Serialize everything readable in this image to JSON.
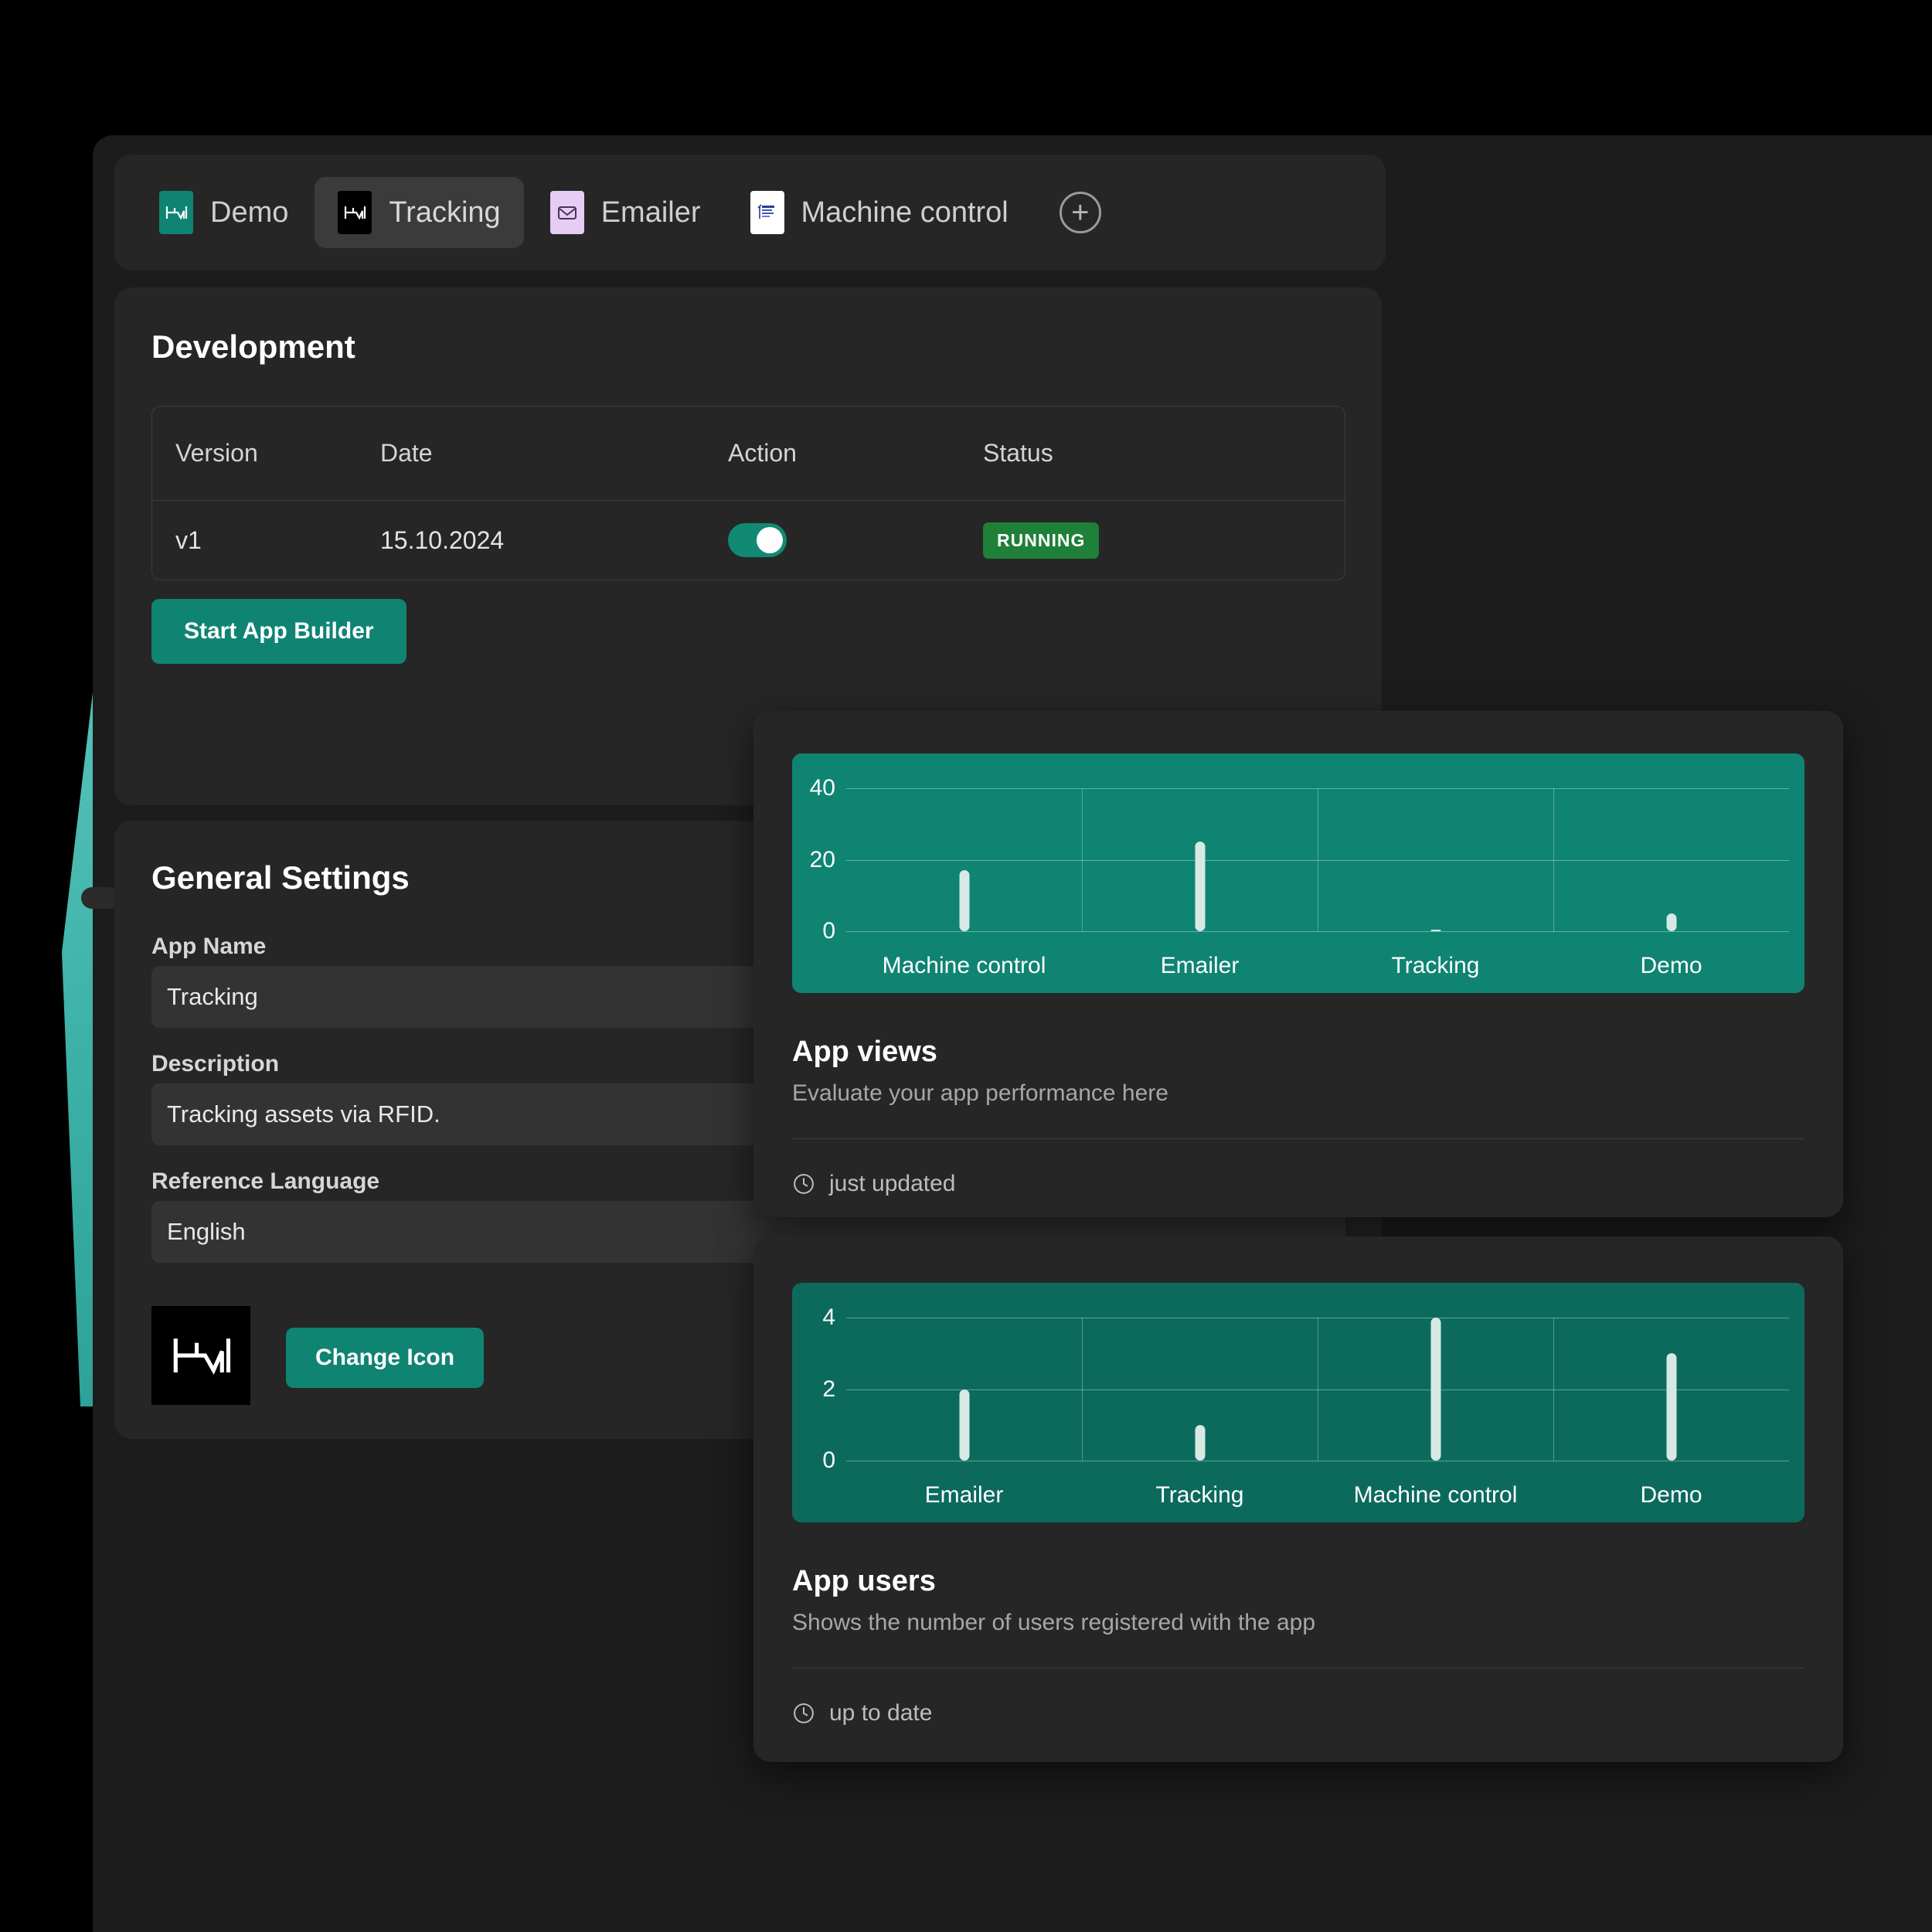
{
  "tabs": [
    {
      "label": "Demo",
      "icon": "waveform-icon",
      "icon_bg": "#0f8473",
      "active": false
    },
    {
      "label": "Tracking",
      "icon": "waveform-icon",
      "icon_bg": "#000000",
      "active": true
    },
    {
      "label": "Emailer",
      "icon": "envelope-icon",
      "icon_bg": "#e6cdf5",
      "active": false
    },
    {
      "label": "Machine control",
      "icon": "document-icon",
      "icon_bg": "#ffffff",
      "active": false
    }
  ],
  "tab_add_label": "+",
  "development": {
    "title": "Development",
    "columns": [
      "Version",
      "Date",
      "Action",
      "Status"
    ],
    "rows": [
      {
        "version": "v1",
        "date": "15.10.2024",
        "action_on": true,
        "status": "RUNNING"
      }
    ],
    "status_color": "#1f8038",
    "start_button": "Start App Builder"
  },
  "settings": {
    "title": "General Settings",
    "app_name_label": "App Name",
    "app_name_value": "Tracking",
    "app_name_placeholder": "App Name",
    "description_label": "Description",
    "description_value": "Tracking assets via RFID.",
    "description_placeholder": "Description",
    "reference_language_label": "Reference Language",
    "reference_language_value": "English",
    "reference_language_placeholder": "Reference Language",
    "change_icon_button": "Change Icon"
  },
  "views_card": {
    "heading": "App views",
    "subtitle": "Evaluate your app performance here",
    "footer": "just updated"
  },
  "users_card": {
    "heading": "App users",
    "subtitle": "Shows the number of users registered with the app",
    "footer": "up to date"
  },
  "colors": {
    "accent": "#0f8473",
    "chart_bg_views": "#0f8473",
    "chart_bg_users": "#0c6a5d",
    "bar": "#d7e9e4",
    "status_running": "#1f8038",
    "card_bg": "#262626",
    "window_bg": "#1c1c1c"
  },
  "chart_data": [
    {
      "type": "bar",
      "title": "App views",
      "categories": [
        "Machine control",
        "Emailer",
        "Tracking",
        "Demo"
      ],
      "values": [
        17,
        25,
        0.5,
        5
      ],
      "yticks": [
        0,
        20,
        40
      ],
      "ylim": [
        0,
        40
      ],
      "xlabel": "",
      "ylabel": "",
      "grid": true,
      "legend": "none"
    },
    {
      "type": "bar",
      "title": "App users",
      "categories": [
        "Emailer",
        "Tracking",
        "Machine control",
        "Demo"
      ],
      "values": [
        2,
        1,
        4,
        3
      ],
      "yticks": [
        0,
        2,
        4
      ],
      "ylim": [
        0,
        4
      ],
      "xlabel": "",
      "ylabel": "",
      "grid": true,
      "legend": "none"
    }
  ]
}
